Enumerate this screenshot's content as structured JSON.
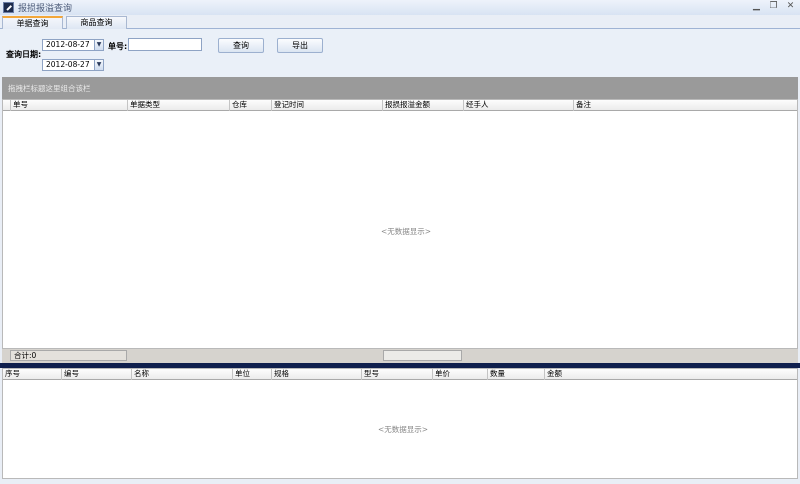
{
  "window": {
    "title": "报损报溢查询"
  },
  "tabs": [
    {
      "label": "单据查询",
      "active": true
    },
    {
      "label": "商品查询",
      "active": false
    }
  ],
  "filters": {
    "date_label": "查询日期:",
    "date_from": "2012-08-27",
    "date_to": "2012-08-27",
    "doc_no_label": "单号:",
    "doc_no_value": "",
    "query_button": "查询",
    "export_button": "导出"
  },
  "group_bar": {
    "text": "拖拽栏标题这里组合该栏"
  },
  "grid1": {
    "columns": [
      "单号",
      "单据类型",
      "仓库",
      "登记时间",
      "报损报溢金额",
      "经手人",
      "备注"
    ],
    "empty_text": "<无数据显示>",
    "total_label": "合计:0"
  },
  "grid2": {
    "columns": [
      "序号",
      "编号",
      "名称",
      "单位",
      "规格",
      "型号",
      "单价",
      "数量",
      "金额"
    ],
    "empty_text": "<无数据显示>"
  },
  "icons": {
    "app": "app-icon",
    "minimize": "minimize-icon",
    "restore": "restore-icon",
    "close": "close-icon",
    "dropdown": "chevron-down-icon"
  },
  "colors": {
    "accent_tab": "#f3a73a",
    "splitter": "#0f1f4d",
    "group_bar": "#9a9a9a"
  }
}
